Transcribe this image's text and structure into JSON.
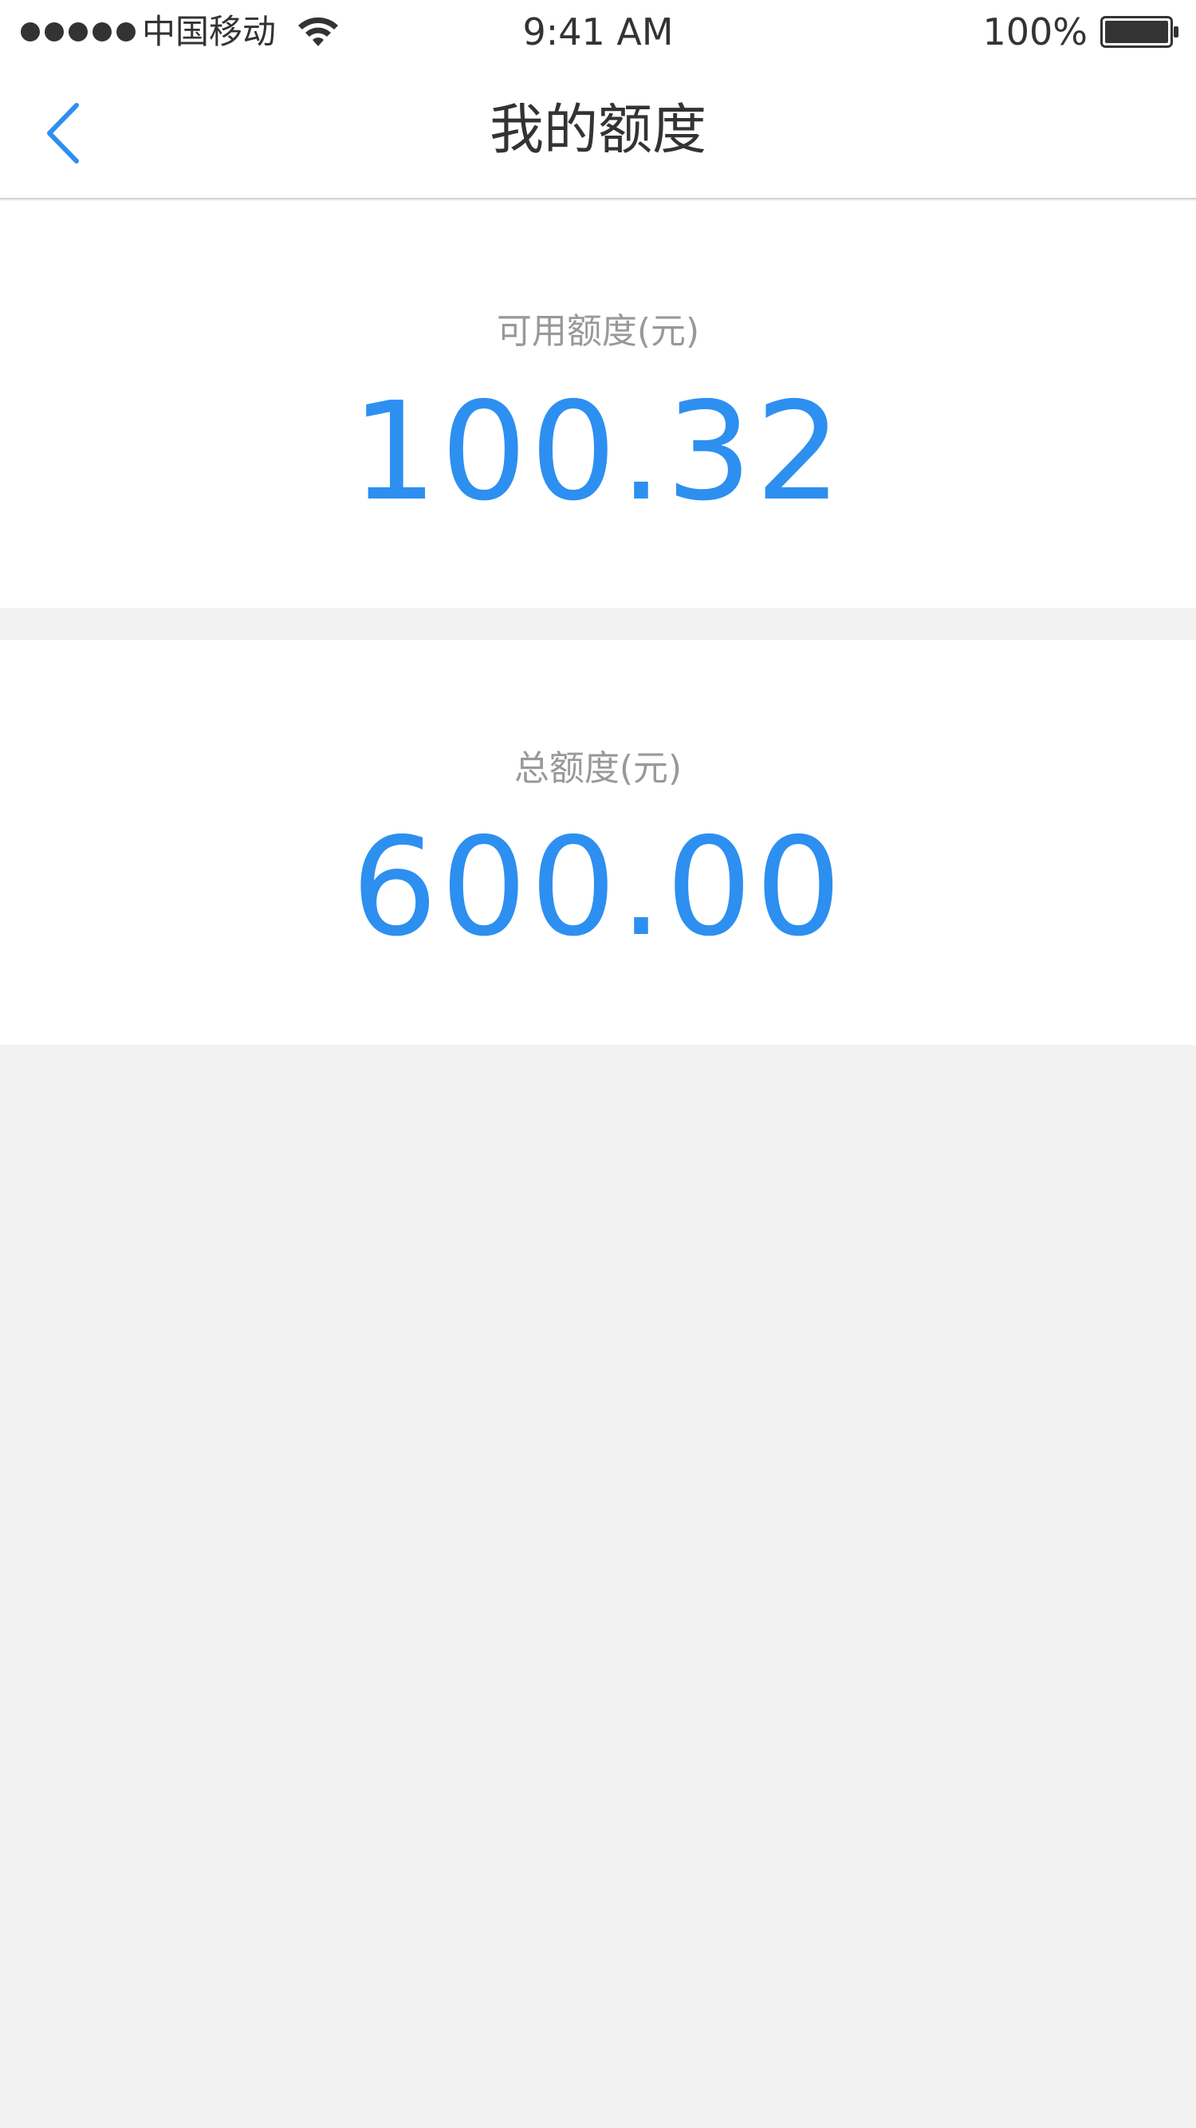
{
  "status_bar": {
    "carrier": "中国移动",
    "time": "9:41 AM",
    "battery": "100%",
    "signal_icon": "signal-dots-icon",
    "wifi_icon": "wifi-icon",
    "battery_icon": "battery-icon"
  },
  "nav": {
    "title": "我的额度",
    "back_icon": "chevron-left-icon"
  },
  "available": {
    "label": "可用额度(元)",
    "value": "100.32"
  },
  "total": {
    "label": "总额度(元)",
    "value": "600.00"
  },
  "colors": {
    "accent": "#2d8ff0",
    "background": "#f2f2f2",
    "card": "#ffffff",
    "label": "#999999",
    "text": "#333333"
  }
}
